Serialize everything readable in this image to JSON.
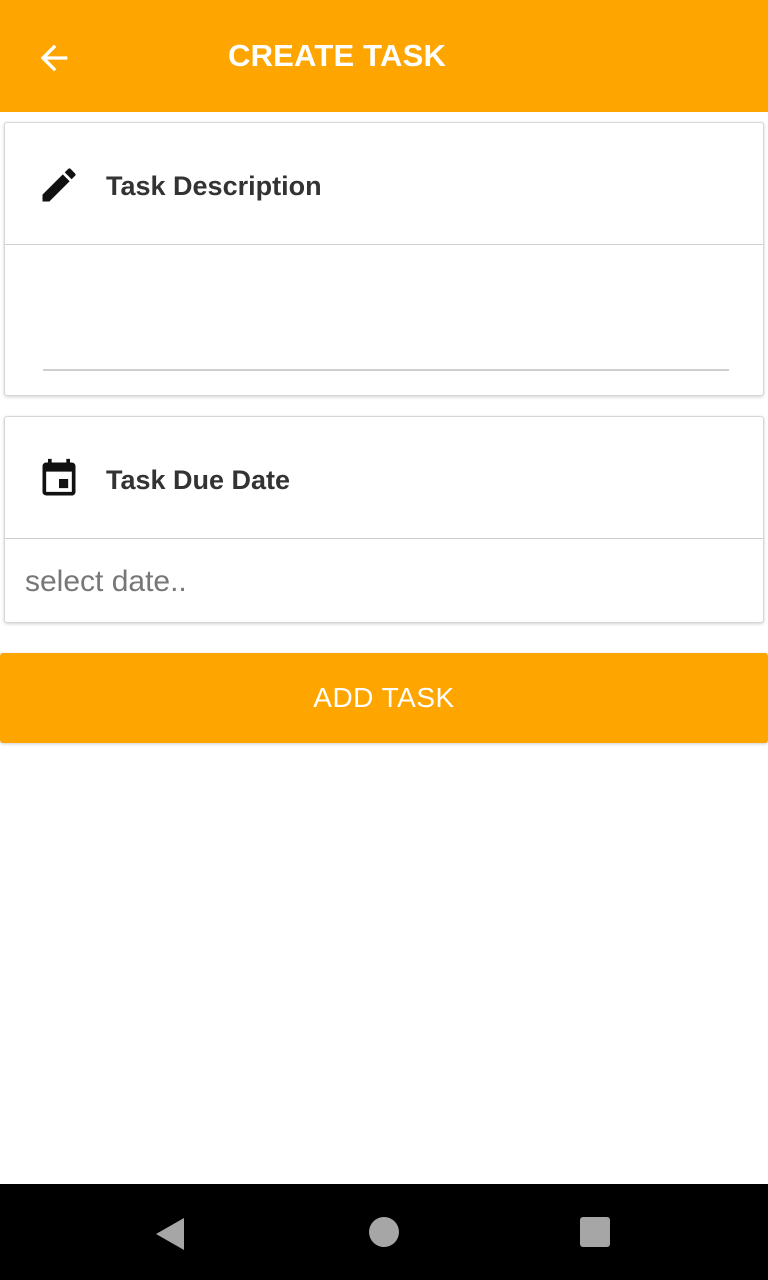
{
  "appbar": {
    "title": "CREATE TASK",
    "color": "#FFA500",
    "back_icon": "arrow-back-icon"
  },
  "description_card": {
    "icon": "pencil-icon",
    "title": "Task Description",
    "input_value": "",
    "input_placeholder": ""
  },
  "date_card": {
    "icon": "calendar-icon",
    "title": "Task Due Date",
    "input_value": "",
    "input_placeholder": "select date.."
  },
  "add_button": {
    "label": "ADD TASK"
  },
  "system_nav": {
    "back_icon": "nav-back-icon",
    "home_icon": "nav-home-icon",
    "recents_icon": "nav-recents-icon"
  }
}
